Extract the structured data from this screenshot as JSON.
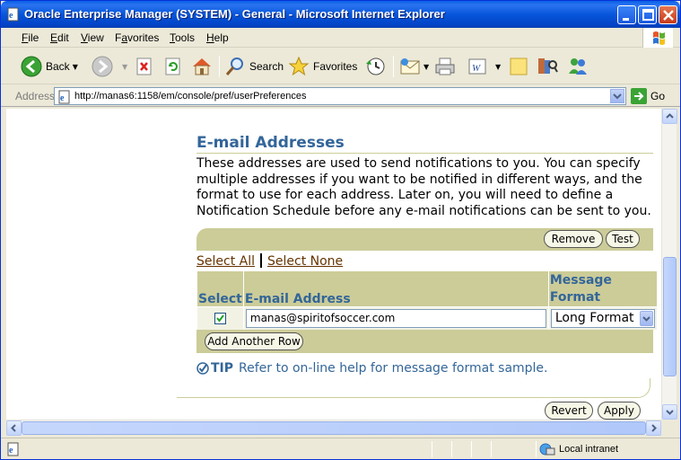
{
  "window": {
    "title": "Oracle Enterprise Manager (SYSTEM) - General - Microsoft Internet Explorer"
  },
  "menu": [
    {
      "label": "File",
      "key": "F"
    },
    {
      "label": "Edit",
      "key": "E"
    },
    {
      "label": "View",
      "key": "V"
    },
    {
      "label": "Favorites",
      "key": "a"
    },
    {
      "label": "Tools",
      "key": "T"
    },
    {
      "label": "Help",
      "key": "H"
    }
  ],
  "toolbar": {
    "back_label": "Back",
    "search_label": "Search",
    "favorites_label": "Favorites"
  },
  "address": {
    "label": "Address",
    "url": "http://manas6:1158/em/console/pref/userPreferences",
    "go_label": "Go"
  },
  "page": {
    "section_title": "E-mail Addresses",
    "description": "These addresses are used to send notifications to you. You can specify multiple addresses if you want to be notified in different ways, and the format to use for each address. Later on, you will need to define a Notification Schedule before any e-mail notifications can be sent to you.",
    "remove_label": "Remove",
    "test_label": "Test",
    "select_all_label": "Select All",
    "select_none_label": "Select None",
    "table": {
      "col_select": "Select",
      "col_email": "E-mail Address",
      "col_format": "Message Format",
      "rows": [
        {
          "checked": true,
          "email": "manas@spiritofsoccer.com",
          "format": "Long Format"
        }
      ]
    },
    "add_row_label": "Add Another Row",
    "tip_label": "TIP",
    "tip_text": "Refer to on-line help for message format sample.",
    "revert_label": "Revert",
    "apply_label": "Apply"
  },
  "status": {
    "zone": "Local intranet"
  }
}
